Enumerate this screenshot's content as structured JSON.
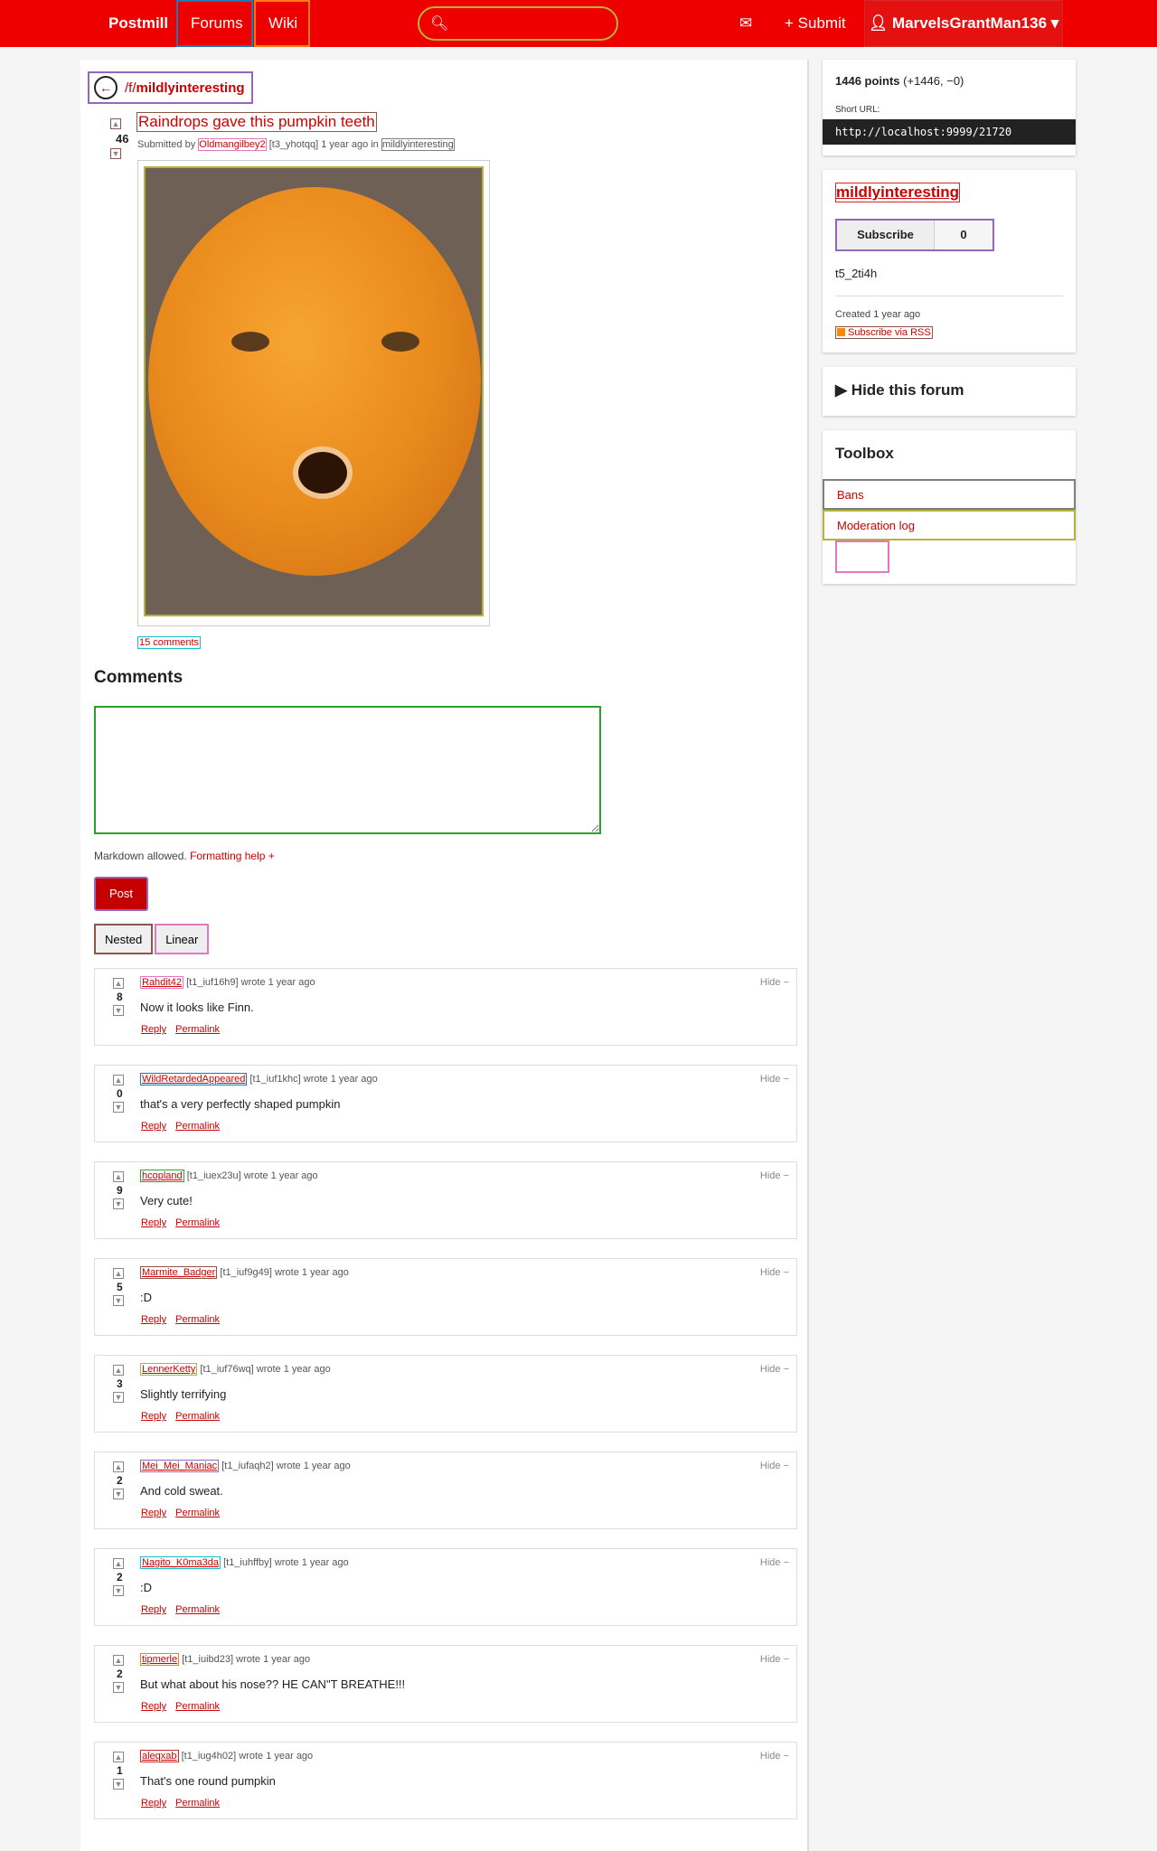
{
  "navbar": {
    "brand": "Postmill",
    "forums": "Forums",
    "wiki": "Wiki",
    "search_placeholder": "",
    "submit": "Submit",
    "user": "MarvelsGrantMan136",
    "icons": {
      "search": "search-icon",
      "mail": "envelope-icon",
      "plus": "plus-icon",
      "user": "user-icon",
      "caret": "caret-down-icon"
    }
  },
  "forum": {
    "prefix": "/f/",
    "name": "mildlyinteresting"
  },
  "post": {
    "score": "46",
    "title": "Raindrops gave this pumpkin teeth",
    "submitted_by": "Submitted by",
    "author": "Oldmangilbey2",
    "id": "[t3_yhotqq]",
    "age": "1 year ago in",
    "forum_tag": "mildlyinteresting",
    "comments_link": "15 comments"
  },
  "comments_section": {
    "heading": "Comments",
    "markdown_note": "Markdown allowed.",
    "formatting_help": "Formatting help +",
    "post_button": "Post",
    "nested": "Nested",
    "linear": "Linear"
  },
  "comments": [
    {
      "author": "Rahdit42",
      "id": "[t1_iuf16h9]",
      "when": "wrote 1 year ago",
      "score": "8",
      "body": "Now it looks like Finn.",
      "reply": "Reply",
      "permalink": "Permalink",
      "hide": "Hide −"
    },
    {
      "author": "WildRetardedAppeared",
      "id": "[t1_iuf1khc]",
      "when": "wrote 1 year ago",
      "score": "0",
      "body": "that's a very perfectly shaped pumpkin",
      "reply": "Reply",
      "permalink": "Permalink",
      "hide": "Hide −"
    },
    {
      "author": "hcopland",
      "id": "[t1_iuex23u]",
      "when": "wrote 1 year ago",
      "score": "9",
      "body": "Very cute!",
      "reply": "Reply",
      "permalink": "Permalink",
      "hide": "Hide −"
    },
    {
      "author": "Marmite_Badger",
      "id": "[t1_iuf9g49]",
      "when": "wrote 1 year ago",
      "score": "5",
      "body": ":D",
      "reply": "Reply",
      "permalink": "Permalink",
      "hide": "Hide −"
    },
    {
      "author": "LennerKetty",
      "id": "[t1_iuf76wq]",
      "when": "wrote 1 year ago",
      "score": "3",
      "body": "Slightly terrifying",
      "reply": "Reply",
      "permalink": "Permalink",
      "hide": "Hide −"
    },
    {
      "author": "Mei_Mei_Maniac",
      "id": "[t1_iufaqh2]",
      "when": "wrote 1 year ago",
      "score": "2",
      "body": "And cold sweat.",
      "reply": "Reply",
      "permalink": "Permalink",
      "hide": "Hide −"
    },
    {
      "author": "Nagito_K0ma3da",
      "id": "[t1_iuhffby]",
      "when": "wrote 1 year ago",
      "score": "2",
      "body": ":D",
      "reply": "Reply",
      "permalink": "Permalink",
      "hide": "Hide −"
    },
    {
      "author": "tipmerle",
      "id": "[t1_iuibd23]",
      "when": "wrote 1 year ago",
      "score": "2",
      "body": "But what about his nose?? HE CAN\"T BREATHE!!!",
      "reply": "Reply",
      "permalink": "Permalink",
      "hide": "Hide −"
    },
    {
      "author": "aleqxab",
      "id": "[t1_iug4h02]",
      "when": "wrote 1 year ago",
      "score": "1",
      "body": "That's one round pumpkin",
      "reply": "Reply",
      "permalink": "Permalink",
      "hide": "Hide −"
    }
  ],
  "sidebar": {
    "points": "1446 points",
    "points_detail": "(+1446, −0)",
    "short_url_label": "Short URL:",
    "short_url": "http://localhost:9999/21720",
    "forum_name": "mildlyinteresting",
    "subscribe": "Subscribe",
    "subscriber_count": "0",
    "forum_id": "t5_2ti4h",
    "created": "Created 1 year ago",
    "rss": "Subscribe via RSS",
    "hide_forum": "Hide this forum",
    "toolbox_title": "Toolbox",
    "bans": "Bans",
    "moderation_log": "Moderation log"
  },
  "colors": {
    "brand": "#ee0000",
    "link": "#cc0000",
    "post_button": "#c40000"
  }
}
